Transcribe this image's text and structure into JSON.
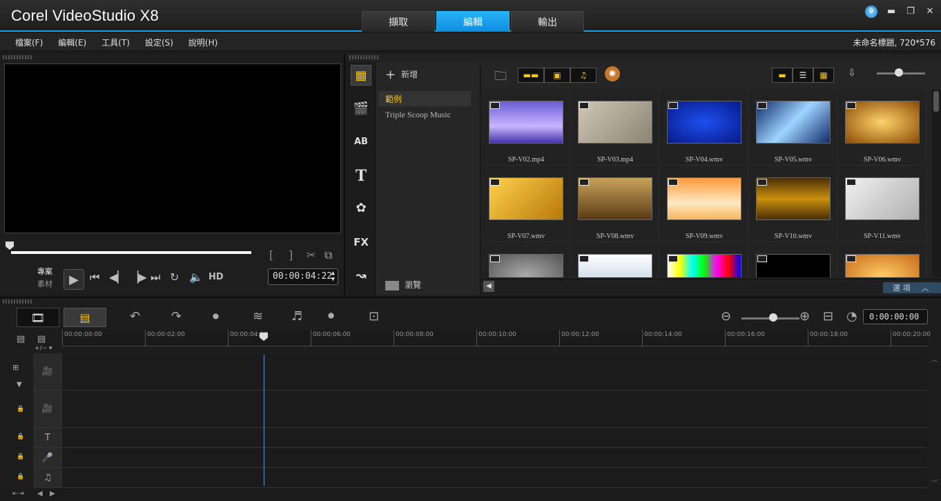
{
  "app": {
    "title": "Corel VideoStudio X8"
  },
  "tabs": [
    "擷取",
    "編輯",
    "輸出"
  ],
  "active_tab": 1,
  "window": {
    "globe": "✲",
    "minimize": "▬",
    "restore": "❐",
    "close": "✕"
  },
  "menu": [
    "檔案(F)",
    "編輯(E)",
    "工具(T)",
    "設定(S)",
    "說明(H)"
  ],
  "project": {
    "info": "未命名標題, 720*576"
  },
  "preview": {
    "mode_project": "專案",
    "mode_clip": "素材",
    "hd": "HD",
    "timecode": "00:00:04:22",
    "mark_in": "[",
    "mark_out": "]"
  },
  "library": {
    "add_label": "新增",
    "folders": [
      "範例",
      "Triple Scoop Music"
    ],
    "selected_folder": 0,
    "browse_label": "瀏覽",
    "options_label": "選 項",
    "side_icons": [
      "media-icon",
      "instant-project-icon",
      "transition-icon",
      "title-icon",
      "graphic-icon",
      "filter-icon",
      "motion-path-icon"
    ],
    "thumbs": [
      {
        "name": "SP-V02.mp4",
        "color": "linear-gradient(#6b5bd6,#c9b6ff 60%,#4433aa)"
      },
      {
        "name": "SP-V03.mp4",
        "color": "linear-gradient(135deg,#cfc8b6,#8c8472)"
      },
      {
        "name": "SP-V04.wmv",
        "color": "radial-gradient(#1e4ff0,#071a8a)"
      },
      {
        "name": "SP-V05.wmv",
        "color": "linear-gradient(135deg,#0f2a6a,#9fd4ff 50%,#0f2a6a)"
      },
      {
        "name": "SP-V06.wmv",
        "color": "radial-gradient(#ffd36a,#8a4a06)"
      },
      {
        "name": "SP-V07.wmv",
        "color": "linear-gradient(135deg,#ffd24a,#b8780a)"
      },
      {
        "name": "SP-V08.wmv",
        "color": "linear-gradient(#c9a35a,#5a3a15)"
      },
      {
        "name": "SP-V09.wmv",
        "color": "linear-gradient(#ff9a3c,#ffe8c2 60%,#f7b45e)"
      },
      {
        "name": "SP-V10.wmv",
        "color": "linear-gradient(#4a2e06,#c9900e 50%,#4a2e06)"
      },
      {
        "name": "SP-V11.wmv",
        "color": "linear-gradient(135deg,#f0f0f0,#b0b0b0)"
      },
      {
        "name": "",
        "color": "radial-gradient(#aaa,#555)"
      },
      {
        "name": "",
        "color": "linear-gradient(#fff,#b0c4de)"
      },
      {
        "name": "",
        "color": "linear-gradient(90deg,#fff,#ff0,#0ff,#0f0,#f0f,#f00,#00f)"
      },
      {
        "name": "",
        "color": "#000"
      },
      {
        "name": "",
        "color": "radial-gradient(#ffcc66,#c66a1a)"
      }
    ]
  },
  "timeline": {
    "timecode": "0:00:00:00",
    "ruler": [
      "00:00:00:00",
      "00:00:02:00",
      "00:00:04:00",
      "00:00:06:00",
      "00:00:08:00",
      "00:00:10:00",
      "00:00:12:00",
      "00:00:14:00",
      "00:00:16:00",
      "00:00:18:00",
      "00:00:20:00"
    ],
    "tracks": [
      "video-track",
      "overlay-track",
      "title-track",
      "voice-track",
      "music-track"
    ],
    "add_remove": "+/− ▾"
  },
  "colors": {
    "accent": "#1aa0e8",
    "folder_selected": "#f5c51a",
    "playhead": "#6b8fd6"
  }
}
